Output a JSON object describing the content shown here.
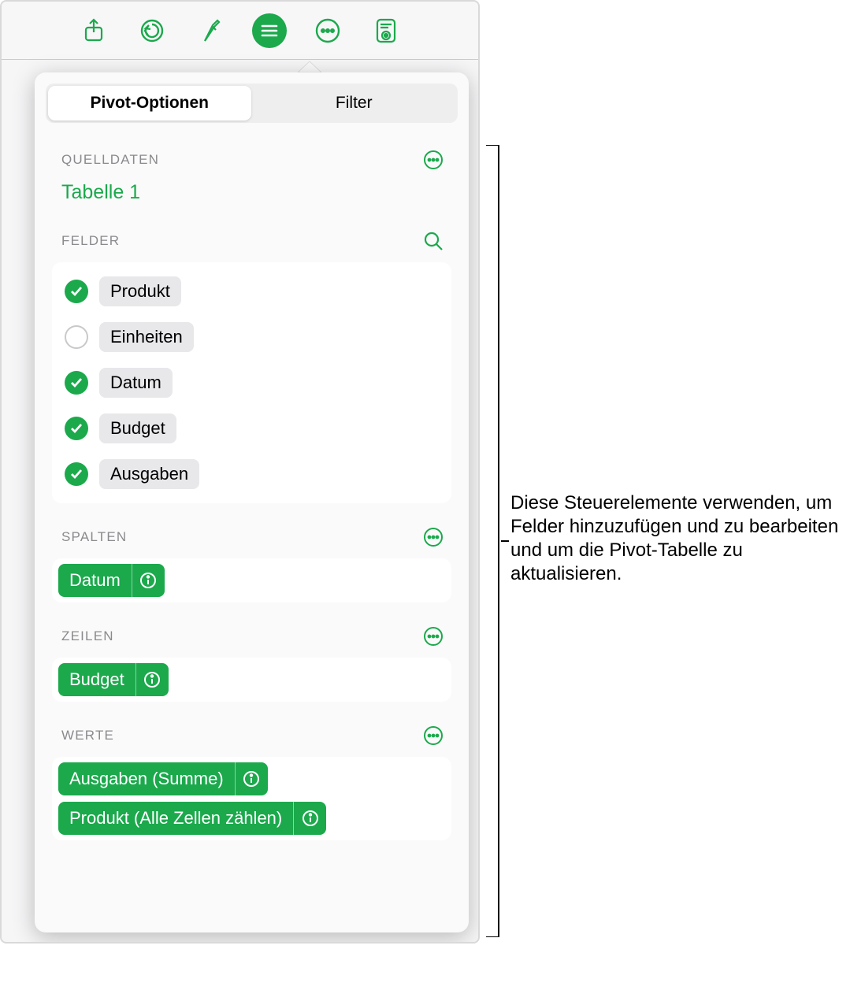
{
  "accent": "#1ba94c",
  "toolbar": {
    "buttons": [
      "share-icon",
      "undo-icon",
      "format-icon",
      "pivot-icon",
      "more-icon",
      "organize-icon"
    ]
  },
  "tabs": {
    "pivot": "Pivot-Optionen",
    "filter": "Filter"
  },
  "source": {
    "label": "QUELLDATEN",
    "name": "Tabelle 1"
  },
  "fields": {
    "label": "FELDER",
    "items": [
      {
        "label": "Produkt",
        "checked": true
      },
      {
        "label": "Einheiten",
        "checked": false
      },
      {
        "label": "Datum",
        "checked": true
      },
      {
        "label": "Budget",
        "checked": true
      },
      {
        "label": "Ausgaben",
        "checked": true
      }
    ]
  },
  "columns": {
    "label": "SPALTEN",
    "chips": [
      "Datum"
    ]
  },
  "rows": {
    "label": "ZEILEN",
    "chips": [
      "Budget"
    ]
  },
  "values": {
    "label": "WERTE",
    "chips": [
      "Ausgaben (Summe)",
      "Produkt (Alle Zellen zählen)"
    ]
  },
  "callout": "Diese Steuerelemente verwenden, um Felder hinzuzufügen und zu bearbeiten und um die Pivot-Tabelle zu aktualisieren."
}
